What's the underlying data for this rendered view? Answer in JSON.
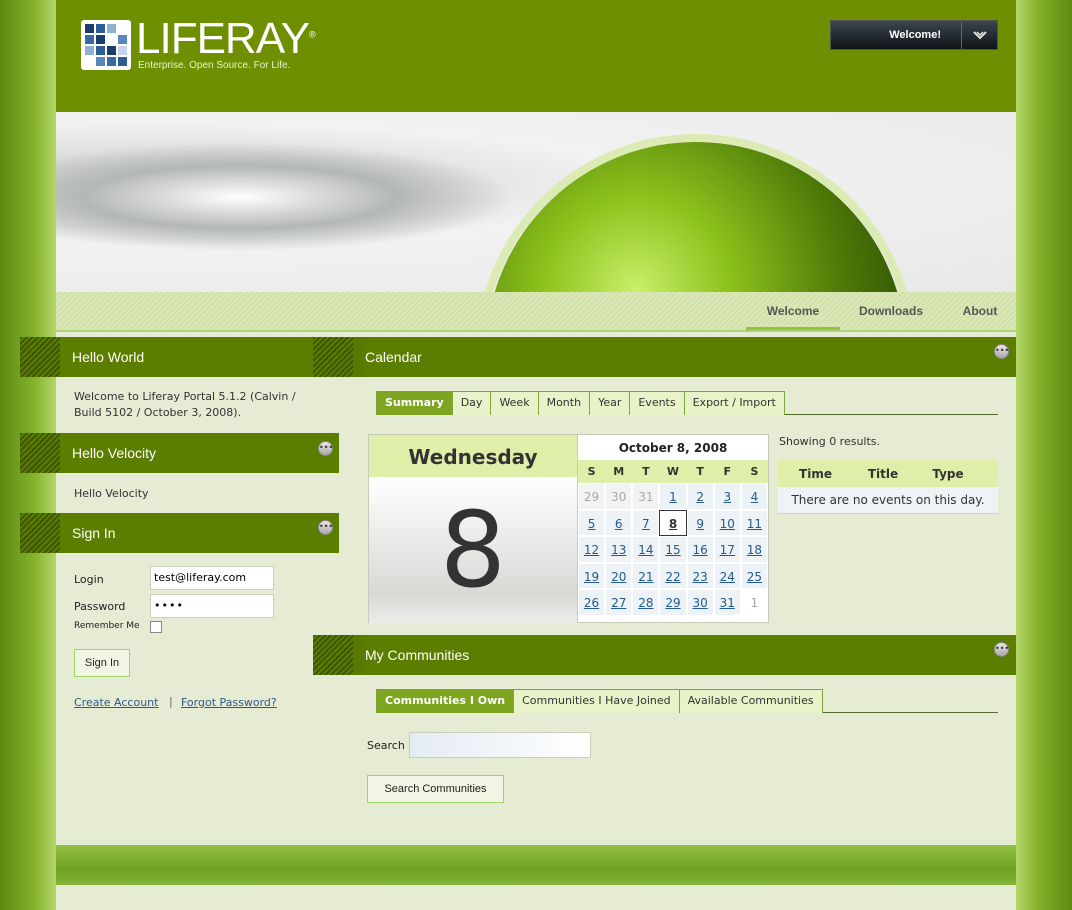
{
  "header": {
    "logo_text": "LIFERAY",
    "logo_trademark": "®",
    "tagline": "Enterprise. Open Source. For Life.",
    "welcome_label": "Welcome!",
    "dock_icon": "chevron-down-icon"
  },
  "nav": {
    "items": [
      {
        "label": "Welcome",
        "active": true
      },
      {
        "label": "Downloads",
        "active": false
      },
      {
        "label": "About",
        "active": false
      }
    ]
  },
  "hello_world": {
    "title": "Hello World",
    "text": "Welcome to Liferay Portal 5.1.2 (Calvin / Build 5102 / October 3, 2008)."
  },
  "hello_velocity": {
    "title": "Hello Velocity",
    "text": "Hello Velocity",
    "menu_icon": "options-icon"
  },
  "sign_in": {
    "title": "Sign In",
    "login_label": "Login",
    "login_value": "test@liferay.com",
    "password_label": "Password",
    "password_value": "••••",
    "remember_label": "Remember Me",
    "button_label": "Sign In",
    "create_account": "Create Account",
    "separator": "|",
    "forgot_password": "Forgot Password?"
  },
  "calendar": {
    "title": "Calendar",
    "tabs": [
      "Summary",
      "Day",
      "Week",
      "Month",
      "Year",
      "Events",
      "Export / Import"
    ],
    "active_tab": "Summary",
    "weekday": "Wednesday",
    "day_number": "8",
    "mini_title": "October 8, 2008",
    "dow": [
      "S",
      "M",
      "T",
      "W",
      "T",
      "F",
      "S"
    ],
    "weeks": [
      [
        "29",
        "30",
        "31",
        "1",
        "2",
        "3",
        "4"
      ],
      [
        "5",
        "6",
        "7",
        "8",
        "9",
        "10",
        "11"
      ],
      [
        "12",
        "13",
        "14",
        "15",
        "16",
        "17",
        "18"
      ],
      [
        "19",
        "20",
        "21",
        "22",
        "23",
        "24",
        "25"
      ],
      [
        "26",
        "27",
        "28",
        "29",
        "30",
        "31",
        "1"
      ]
    ],
    "showing": "Showing 0 results.",
    "columns": [
      "Time",
      "Title",
      "Type"
    ],
    "empty_text": "There are no events on this day."
  },
  "communities": {
    "title": "My Communities",
    "tabs": [
      "Communities I Own",
      "Communities I Have Joined",
      "Available Communities"
    ],
    "active_tab": "Communities I Own",
    "search_label": "Search",
    "search_value": "",
    "button_label": "Search Communities"
  },
  "colors": {
    "header": "#6e9000",
    "portlet_title": "#5b7d00",
    "tab_active": "#7da51f",
    "page_bg": "#e6ebd4",
    "link": "#2c5a8a"
  }
}
